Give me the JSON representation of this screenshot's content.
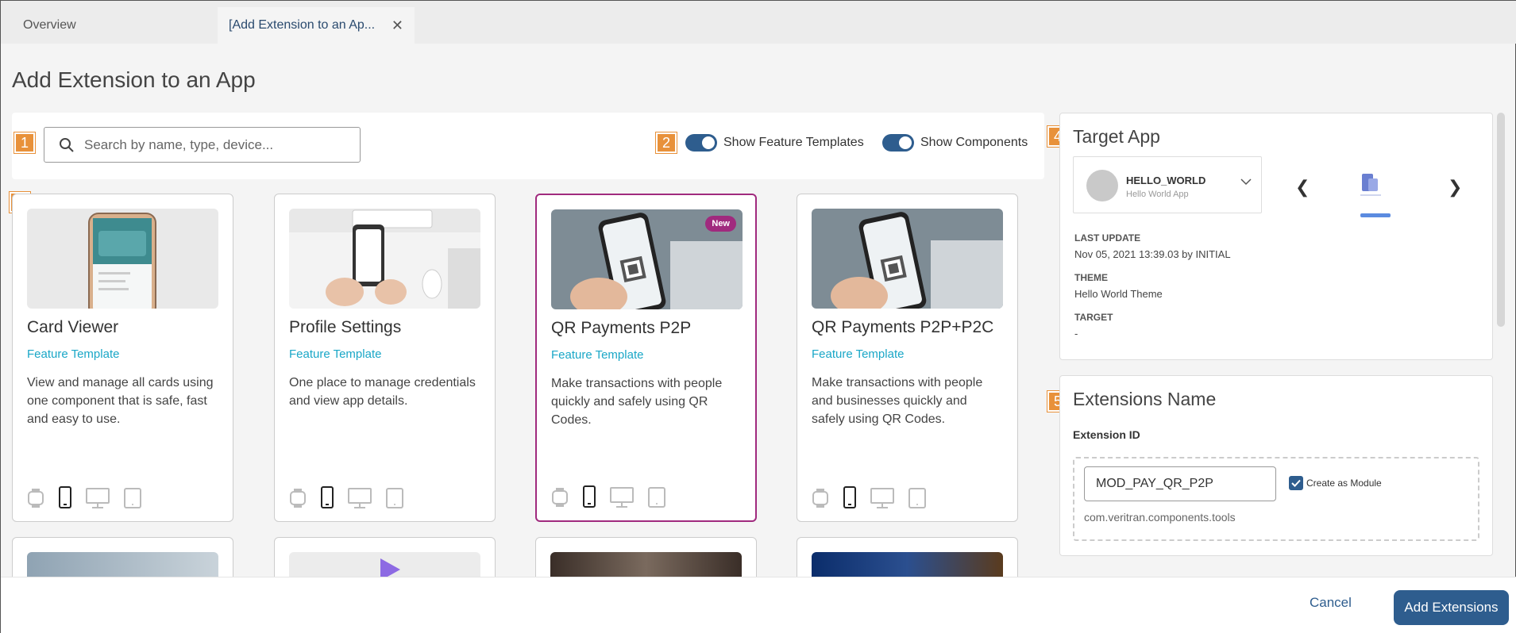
{
  "tabs": [
    {
      "label": "Overview"
    },
    {
      "label": "[Add Extension to an Ap..."
    }
  ],
  "page_title": "Add Extension to an App",
  "callouts": [
    "1",
    "2",
    "3",
    "4",
    "5"
  ],
  "search": {
    "placeholder": "Search by name, type, device...",
    "value": ""
  },
  "toggles": {
    "feature_templates": {
      "label": "Show Feature Templates",
      "on": true
    },
    "components": {
      "label": "Show Components",
      "on": true
    }
  },
  "cards": [
    {
      "title": "Card Viewer",
      "type": "Feature Template",
      "desc": "View and manage all cards using one component that is safe, fast and easy to use."
    },
    {
      "title": "Profile Settings",
      "type": "Feature Template",
      "desc": "One place to manage credentials and view app details."
    },
    {
      "title": "QR Payments P2P",
      "type": "Feature Template",
      "desc": "Make transactions with people quickly and safely using QR Codes.",
      "badge": "New",
      "selected": true
    },
    {
      "title": "QR Payments P2P+P2C",
      "type": "Feature Template",
      "desc": "Make transactions with people and businesses quickly and safely using QR Codes."
    }
  ],
  "devices": [
    "watch-icon",
    "phone-icon",
    "desktop-icon",
    "tablet-icon"
  ],
  "target_app": {
    "title": "Target App",
    "app_name": "HELLO_WORLD",
    "app_sub": "Hello World App",
    "last_update_label": "LAST UPDATE",
    "last_update": "Nov 05, 2021 13:39.03 by INITIAL",
    "theme_label": "THEME",
    "theme": "Hello World Theme",
    "target_label": "TARGET",
    "target": "-",
    "prev": "❮",
    "next": "❯"
  },
  "extensions": {
    "title": "Extensions Name",
    "id_label": "Extension ID",
    "id_value": "MOD_PAY_QR_P2P",
    "module_label": "Create as Module",
    "module_checked": true,
    "package": "com.veritran.components.tools"
  },
  "footer": {
    "cancel": "Cancel",
    "add": "Add Extensions"
  },
  "colors": {
    "accent": "#2e5d8e",
    "link": "#1aa7c7",
    "selected": "#a02a7e",
    "callout": "#e8913a"
  }
}
